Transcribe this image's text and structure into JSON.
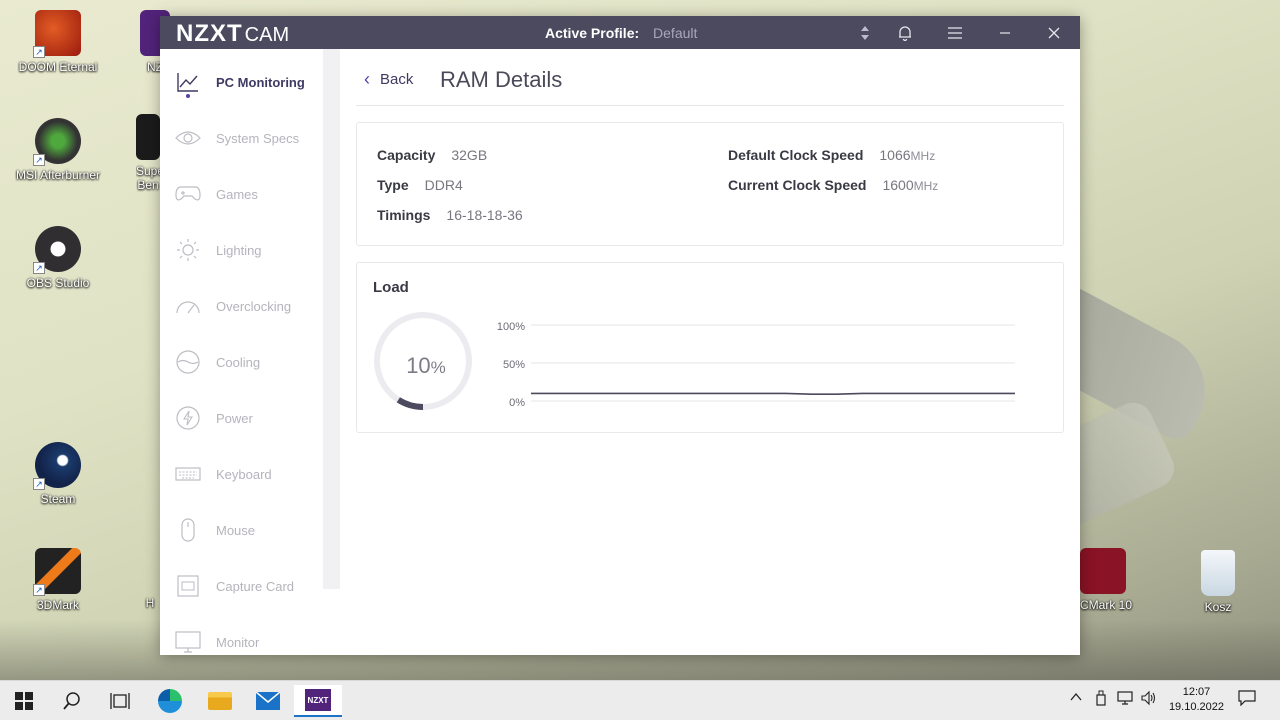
{
  "desktop": {
    "icons": [
      {
        "label": "DOOM Eternal"
      },
      {
        "label": "NZ"
      },
      {
        "label": "MSI Afterburner"
      },
      {
        "label": "Super Ben"
      },
      {
        "label": "OBS Studio"
      },
      {
        "label": "Steam"
      },
      {
        "label": "3DMark"
      },
      {
        "label": "H"
      },
      {
        "label": "CMark 10"
      },
      {
        "label": "Kosz"
      }
    ]
  },
  "window": {
    "brand": "NZXT",
    "brand_suffix": "CAM",
    "profile_label": "Active Profile:",
    "profile_value": "Default",
    "icons": [
      "sort-icon",
      "bell-icon",
      "menu-icon",
      "minimize-icon",
      "close-icon"
    ]
  },
  "sidebar": {
    "items": [
      {
        "label": "PC Monitoring",
        "icon": "chart-line-icon",
        "active": true
      },
      {
        "label": "System Specs",
        "icon": "eye-icon"
      },
      {
        "label": "Games",
        "icon": "gamepad-icon"
      },
      {
        "label": "Lighting",
        "icon": "sun-icon"
      },
      {
        "label": "Overclocking",
        "icon": "speedometer-icon"
      },
      {
        "label": "Cooling",
        "icon": "fan-icon"
      },
      {
        "label": "Power",
        "icon": "bolt-icon"
      },
      {
        "label": "Keyboard",
        "icon": "keyboard-icon"
      },
      {
        "label": "Mouse",
        "icon": "mouse-icon"
      },
      {
        "label": "Capture Card",
        "icon": "capture-card-icon"
      },
      {
        "label": "Monitor",
        "icon": "monitor-icon"
      }
    ]
  },
  "main": {
    "back_label": "Back",
    "title": "RAM Details",
    "specs": {
      "capacity_label": "Capacity",
      "capacity_value": "32GB",
      "type_label": "Type",
      "type_value": "DDR4",
      "timings_label": "Timings",
      "timings_value": "16-18-18-36",
      "default_clock_label": "Default Clock Speed",
      "default_clock_value": "1066",
      "current_clock_label": "Current Clock Speed",
      "current_clock_value": "1600",
      "clock_unit": "MHz"
    },
    "load": {
      "title": "Load",
      "value": "10",
      "unit": "%",
      "gauge_fraction": 0.1,
      "ticks": [
        "100%",
        "50%",
        "0%"
      ]
    }
  },
  "chart_data": {
    "type": "line",
    "title": "",
    "ylim": [
      0,
      100
    ],
    "series": [
      {
        "values": [
          10,
          10,
          10,
          10,
          10,
          10,
          10,
          10,
          10,
          10,
          10,
          9,
          9,
          10,
          10,
          10,
          10,
          10,
          10,
          10
        ]
      }
    ]
  },
  "taskbar": {
    "time": "12:07",
    "date": "19.10.2022",
    "icons": [
      "windows-start-icon",
      "search-icon",
      "task-view-icon",
      "edge-icon",
      "file-explorer-icon",
      "mail-icon",
      "nzxt-cam-icon"
    ],
    "tray_icons": [
      "chevron-up-icon",
      "usb-icon",
      "network-icon",
      "volume-icon",
      "notifications-icon"
    ],
    "nzxt_label": "NZXT"
  }
}
